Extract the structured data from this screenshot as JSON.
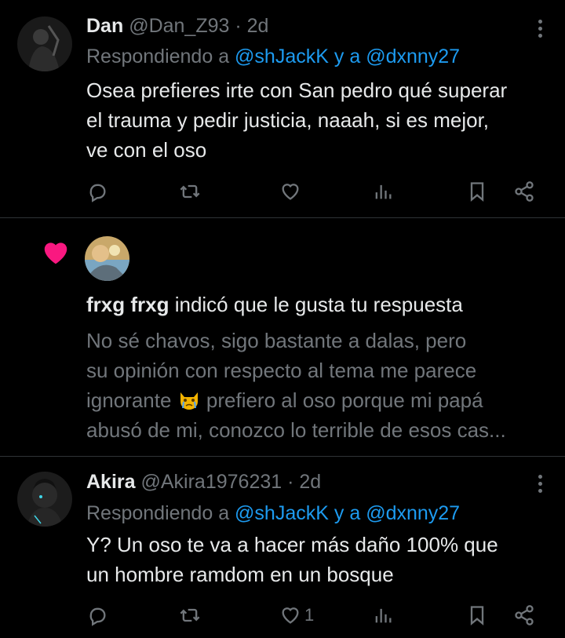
{
  "posts": [
    {
      "name": "Dan",
      "handle": "@Dan_Z93",
      "separator": "·",
      "time": "2d",
      "reply_prefix": "Respondiendo a",
      "reply_mention_1": "@shJackK",
      "reply_joiner": "y a",
      "reply_mention_2": "@dxnny27",
      "text_lines": [
        "Osea prefieres irte con San pedro qué superar",
        "el trauma y pedir justicia, naaah, si es mejor,",
        "ve con el oso"
      ],
      "like_count": ""
    },
    {
      "name": "Akira",
      "handle": "@Akira1976231",
      "separator": "·",
      "time": "2d",
      "reply_prefix": "Respondiendo a",
      "reply_mention_1": "@shJackK",
      "reply_joiner": "y a",
      "reply_mention_2": "@dxnny27",
      "text_lines": [
        "Y? Un oso te va a hacer más daño 100% que",
        "un hombre ramdom en un bosque"
      ],
      "like_count": "1"
    }
  ],
  "notification": {
    "user": "frxg frxg",
    "action": "indicó que le gusta tu respuesta",
    "text_lines": [
      "No sé chavos, sigo bastante a dalas, pero",
      "su opinión con respecto al tema me parece",
      "ignorante",
      "prefiero al oso porque mi papá",
      "abusó de mi, conozco lo terrible de esos cas..."
    ]
  },
  "icons": {
    "reply": "reply-icon",
    "retweet": "retweet-icon",
    "like": "heart-icon",
    "views": "views-icon",
    "bookmark": "bookmark-icon",
    "share": "share-icon",
    "more": "more-icon",
    "notification_like": "heart-filled-icon",
    "emoji": "crying-cat-emoji"
  },
  "colors": {
    "background": "#000000",
    "text": "#e7e9ea",
    "muted": "#71767b",
    "link": "#1d9bf0",
    "like_heart": "#f91880",
    "divider": "#2f3336"
  }
}
